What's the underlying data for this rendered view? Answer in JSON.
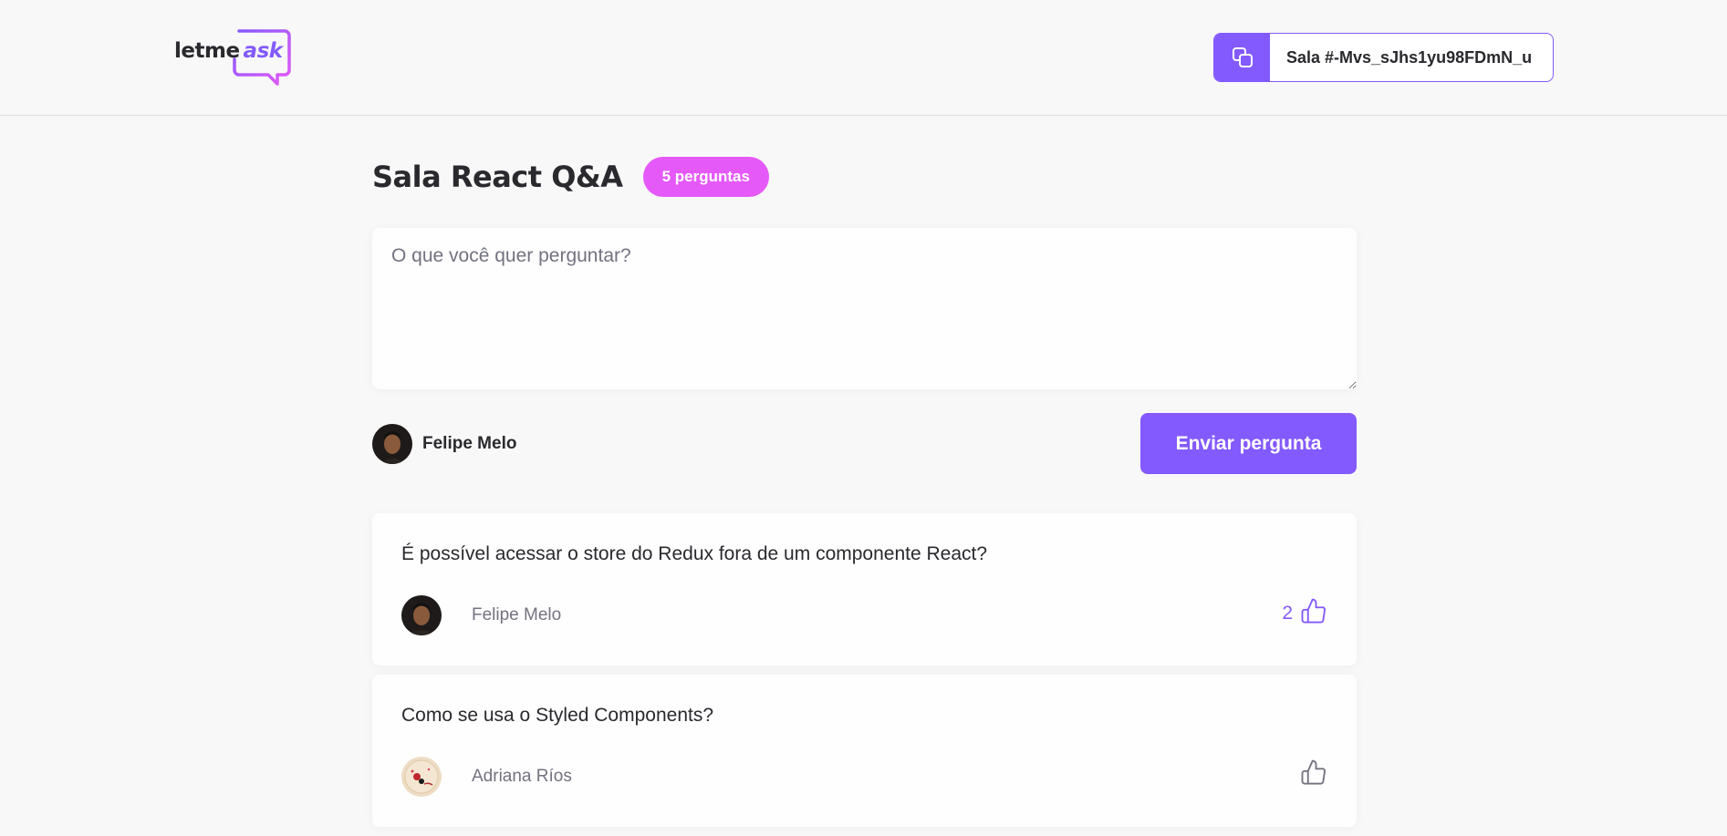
{
  "header": {
    "logo": {
      "text": "letme",
      "accent": "ask"
    },
    "room_code": {
      "label": "Sala #-Mvs_sJhs1yu98FDmN_u",
      "icon": "copy-icon"
    }
  },
  "room": {
    "title": "Sala React Q&A",
    "question_count": "5 perguntas"
  },
  "form": {
    "placeholder": "O que você quer perguntar?",
    "value": "",
    "user_name": "Felipe Melo",
    "submit_label": "Enviar pergunta"
  },
  "questions": [
    {
      "content": "É possível acessar o store do Redux fora de um componente React?",
      "author": "Felipe Melo",
      "like_count": "2",
      "liked": true
    },
    {
      "content": "Como se usa o Styled Components?",
      "author": "Adriana Ríos",
      "like_count": "",
      "liked": false
    }
  ],
  "colors": {
    "primary": "#835afd",
    "badge": "#e559f9",
    "text": "#29292e",
    "muted": "#737380",
    "background": "#f8f8f8"
  }
}
